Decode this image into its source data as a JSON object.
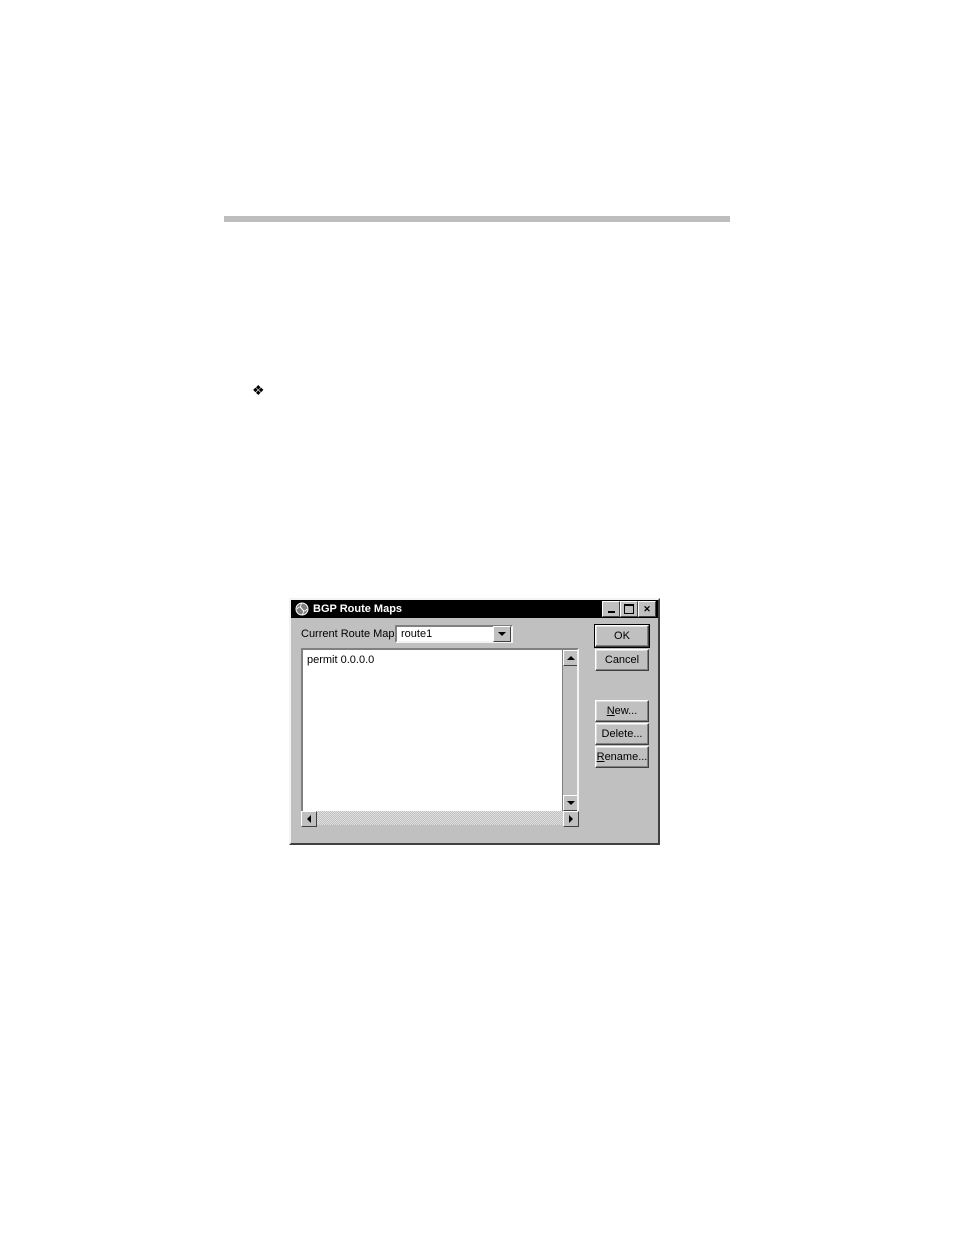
{
  "dialog": {
    "title": "BGP Route Maps",
    "currentRouteMapLabel": "Current Route Map:",
    "currentRouteMapValue": "route1",
    "listItems": [
      "permit 0.0.0.0"
    ],
    "buttons": {
      "ok": "OK",
      "cancel": "Cancel",
      "newU": "N",
      "newRest": "ew...",
      "delete": "Delete...",
      "renameU": "R",
      "renameRest": "ename..."
    }
  }
}
